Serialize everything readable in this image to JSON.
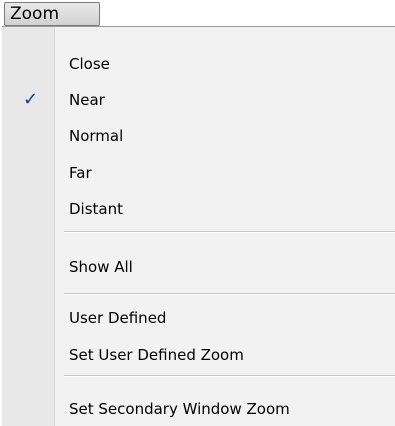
{
  "menubar": {
    "zoom_label": "Zoom"
  },
  "menu": {
    "check_glyph": "✓",
    "items": [
      {
        "label": "Close",
        "checked": false
      },
      {
        "label": "Near",
        "checked": true
      },
      {
        "label": "Normal",
        "checked": false
      },
      {
        "label": "Far",
        "checked": false
      },
      {
        "label": "Distant",
        "checked": false
      },
      {
        "label": "Show All",
        "checked": false
      },
      {
        "label": "User Defined",
        "checked": false
      },
      {
        "label": "Set User Defined Zoom",
        "checked": false
      },
      {
        "label": "Set Secondary Window Zoom",
        "checked": false
      }
    ]
  },
  "colors": {
    "menu_bg": "#f2f2f2",
    "gutter_bg": "#e8e8e8",
    "check_color": "#1a3b8f"
  }
}
